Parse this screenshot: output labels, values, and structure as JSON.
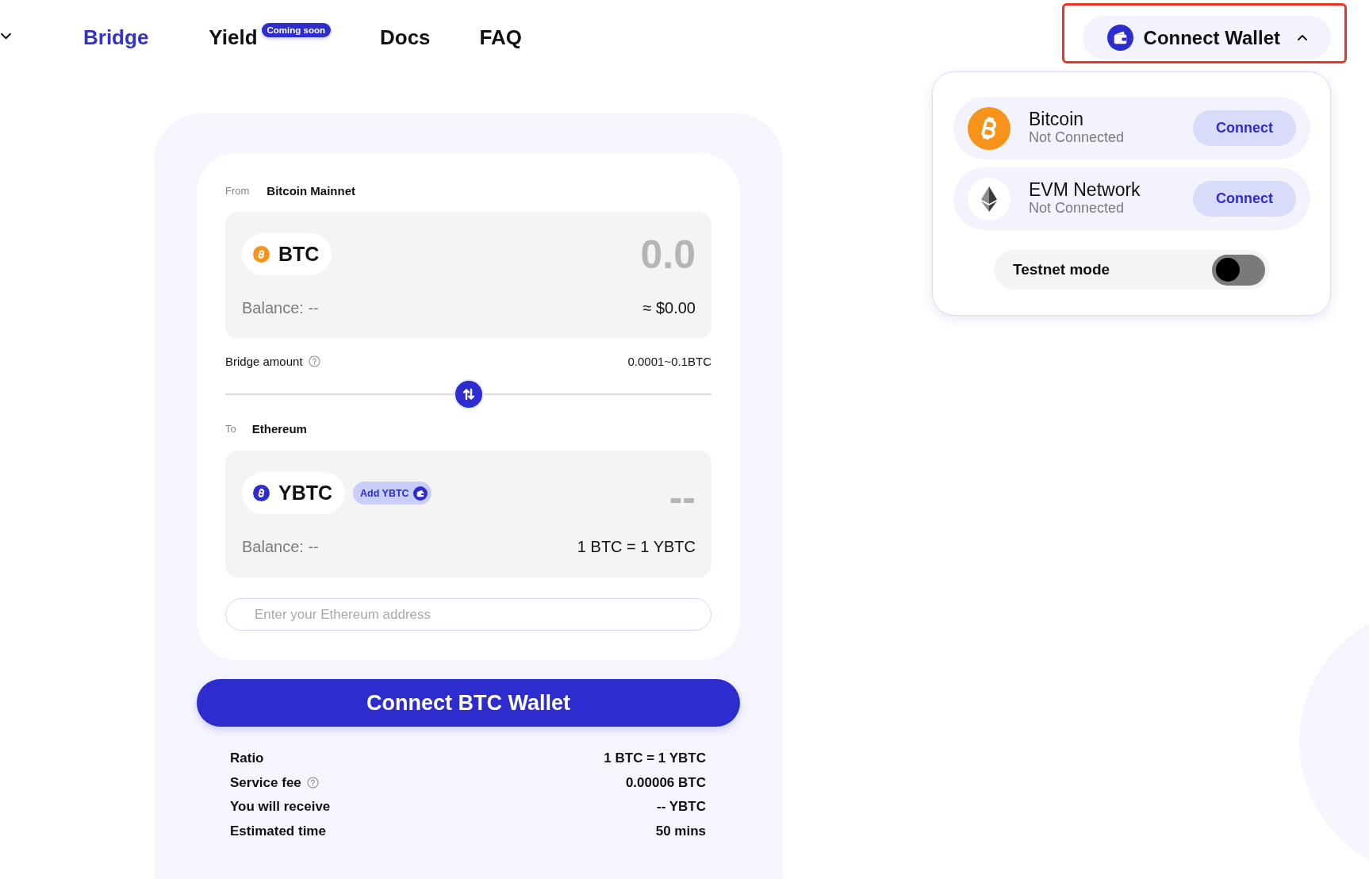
{
  "nav": {
    "items": [
      {
        "label": "Bridge",
        "selected": true
      },
      {
        "label": "Yield",
        "selected": false,
        "badge": "Coming soon"
      },
      {
        "label": "Docs",
        "selected": false
      },
      {
        "label": "FAQ",
        "selected": false
      }
    ]
  },
  "wallet_button": {
    "label": "Connect Wallet",
    "expanded": true,
    "highlighted": true
  },
  "wallet_menu": {
    "networks": [
      {
        "kind": "bitcoin",
        "name": "Bitcoin",
        "status": "Not Connected",
        "action": "Connect"
      },
      {
        "kind": "evm",
        "name": "EVM Network",
        "status": "Not Connected",
        "action": "Connect"
      }
    ],
    "testnet": {
      "label": "Testnet mode",
      "on": false
    }
  },
  "bridge": {
    "from": {
      "label": "From",
      "network": "Bitcoin Mainnet",
      "token": "BTC",
      "amount": {
        "placeholder": "0.0"
      },
      "balance": "Balance: --",
      "fiat_value": "≈ $0.00"
    },
    "limits": {
      "label": "Bridge amount",
      "range": "0.0001~0.1BTC"
    },
    "to": {
      "label": "To",
      "network": "Ethereum",
      "token": "YBTC",
      "add_token": "Add YBTC",
      "amount": "--",
      "balance": "Balance: --",
      "rate": "1 BTC = 1 YBTC"
    },
    "address_field": {
      "placeholder": "Enter your Ethereum address"
    },
    "submit": "Connect BTC Wallet",
    "summary": [
      {
        "label": "Ratio",
        "value": "1 BTC = 1 YBTC",
        "help": false
      },
      {
        "label": "Service fee",
        "value": "0.00006 BTC",
        "help": true
      },
      {
        "label": "You will receive",
        "value": "-- YBTC",
        "help": false
      },
      {
        "label": "Estimated time",
        "value": "50 mins",
        "help": false
      }
    ]
  }
}
